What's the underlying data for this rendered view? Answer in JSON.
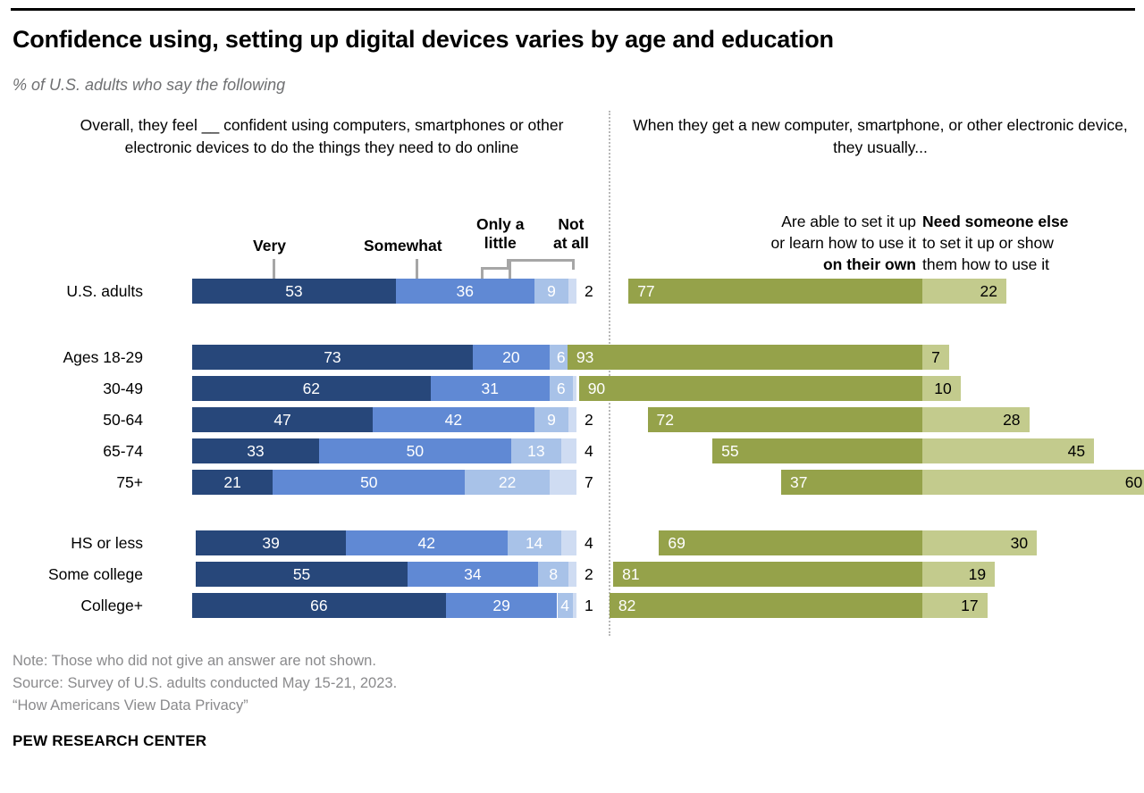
{
  "header": {
    "title": "Confidence using, setting up digital devices varies by age and education",
    "subtitle": "% of U.S. adults who say the following"
  },
  "panels": {
    "left": {
      "question": "Overall, they feel __ confident using computers, smartphones or other electronic devices to do the things they need to do online",
      "legend": {
        "very": "Very",
        "somewhat": "Somewhat",
        "only_a_little": "Only a\nlittle",
        "not_at_all": "Not\nat all"
      }
    },
    "right": {
      "question": "When they get a new computer, smartphone, or other electronic device, they usually...",
      "legend": {
        "own_line1": "Are able to set it up",
        "own_line2": "or learn how to use it",
        "own_line3": "on their own",
        "need_line1": "Need someone else",
        "need_line2": "to set it up or show",
        "need_line3": "them how to use it"
      }
    }
  },
  "colors": {
    "very": "#27477a",
    "somewhat": "#6089d4",
    "only_a_little": "#a8c2e8",
    "not_at_all": "#cfdcf2",
    "own": "#95a24a",
    "need": "#c3cb8d",
    "note_gray": "#8a8a8c",
    "leader_gray": "#a6a6a6"
  },
  "row_labels": [
    "U.S. adults",
    "Ages 18-29",
    "30-49",
    "50-64",
    "65-74",
    "75+",
    "HS or less",
    "Some college",
    "College+"
  ],
  "footer": {
    "note": "Note: Those who did not give an answer are not shown.",
    "source": "Source: Survey of U.S. adults conducted May 15-21, 2023.",
    "report": "“How Americans View Data Privacy”",
    "brand": "PEW RESEARCH CENTER"
  },
  "chart_data": [
    {
      "type": "bar",
      "id": "confidence",
      "orientation": "horizontal",
      "stacked": true,
      "title": "Overall, they feel __ confident using computers, smartphones or other electronic devices to do the things they need to do online",
      "xlabel": "",
      "ylabel": "",
      "grid": false,
      "legend_position": "top",
      "categories": [
        "U.S. adults",
        "Ages 18-29",
        "30-49",
        "50-64",
        "65-74",
        "75+",
        "HS or less",
        "Some college",
        "College+"
      ],
      "series": [
        {
          "name": "Very",
          "values": [
            53,
            73,
            62,
            47,
            33,
            21,
            39,
            55,
            66
          ]
        },
        {
          "name": "Somewhat",
          "values": [
            36,
            20,
            31,
            42,
            50,
            50,
            42,
            34,
            29
          ]
        },
        {
          "name": "Only a little",
          "values": [
            9,
            6,
            6,
            9,
            13,
            22,
            14,
            8,
            4
          ]
        },
        {
          "name": "Not at all",
          "values": [
            2,
            1,
            1,
            2,
            4,
            7,
            4,
            2,
            1
          ]
        }
      ]
    },
    {
      "type": "bar",
      "id": "setup",
      "orientation": "horizontal",
      "stacked": true,
      "title": "When they get a new computer, smartphone, or other electronic device, they usually...",
      "xlabel": "",
      "ylabel": "",
      "grid": false,
      "legend_position": "top",
      "categories": [
        "U.S. adults",
        "Ages 18-29",
        "30-49",
        "50-64",
        "65-74",
        "75+",
        "HS or less",
        "Some college",
        "College+"
      ],
      "series": [
        {
          "name": "Are able to set it up or learn how to use it on their own",
          "values": [
            77,
            93,
            90,
            72,
            55,
            37,
            69,
            81,
            82
          ]
        },
        {
          "name": "Need someone else to set it up or show them how to use it",
          "values": [
            22,
            7,
            10,
            28,
            45,
            60,
            30,
            19,
            17
          ]
        }
      ]
    }
  ]
}
